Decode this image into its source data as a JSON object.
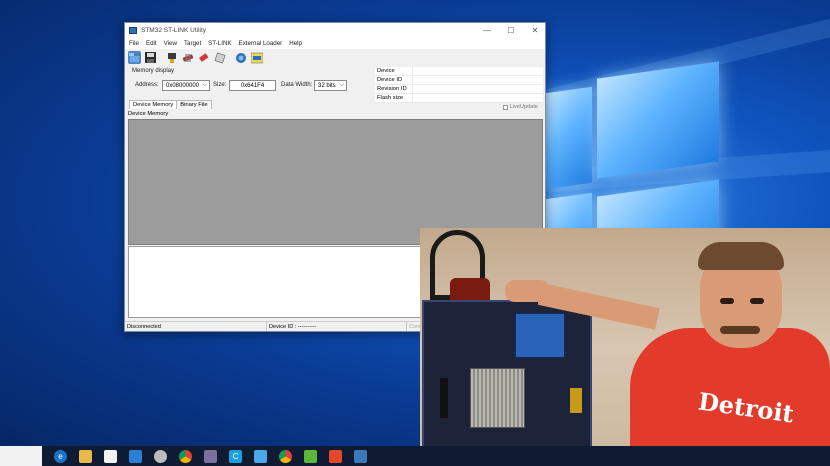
{
  "window": {
    "title": "STM32 ST-LINK Utility",
    "controls": {
      "minimize": "—",
      "maximize": "☐",
      "close": "✕"
    }
  },
  "menu": [
    "File",
    "Edit",
    "View",
    "Target",
    "ST-LINK",
    "External Loader",
    "Help"
  ],
  "toolbar": {
    "icons": [
      "open-file-icon",
      "save-icon",
      "connect-icon",
      "disconnect-icon",
      "erase-icon",
      "program-icon",
      "cpu-icon",
      "swv-icon"
    ]
  },
  "memory_display": {
    "group_label": "Memory display",
    "address_label": "Address:",
    "address_value": "0x08000000",
    "size_label": "Size:",
    "size_value": "0x641F4",
    "data_width_label": "Data Width:",
    "data_width_value": "32 bits"
  },
  "device_info": {
    "rows": [
      "Device",
      "Device ID",
      "Revision ID",
      "Flash size"
    ]
  },
  "tabs": [
    "Device Memory",
    "Binary File"
  ],
  "live_update_label": "LiveUpdate",
  "section_label": "Device Memory",
  "status": {
    "connection": "Disconnected",
    "device_id": "Device ID : ----------",
    "core_state": "Core"
  }
}
